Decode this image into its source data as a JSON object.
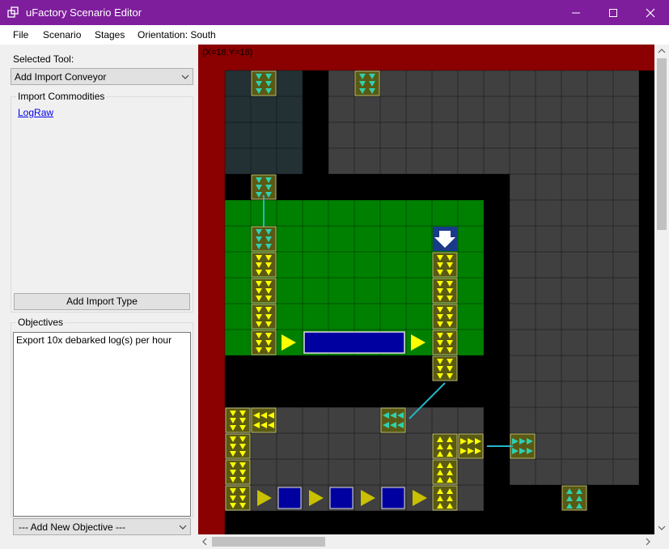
{
  "window": {
    "title": "uFactory Scenario Editor"
  },
  "menu": {
    "file": "File",
    "scenario": "Scenario",
    "stages": "Stages",
    "orientation": "Orientation: South"
  },
  "left": {
    "selected_tool_label": "Selected Tool:",
    "selected_tool_value": "Add Import Conveyor",
    "import_commodities_title": "Import Commodities",
    "commodities": [
      "LogRaw"
    ],
    "add_import_button": "Add Import Type",
    "objectives_title": "Objectives",
    "objectives_text": "Export 10x debarked log(s) per hour",
    "add_objective_value": "--- Add New Objective ---"
  },
  "grid": {
    "coords": "(X=18,Y=16)"
  },
  "colors": {
    "titlebar": "#7e1e9c",
    "border_red": "#8b0000",
    "dark_teal": "#233135",
    "floor_gray": "#404040",
    "green_zone": "#008000",
    "conveyor": "#5a5a14",
    "arrow_yellow": "#ffff00",
    "arrow_teal": "#2fd0b0",
    "machine_blue": "#0000a0",
    "wire": "#22b8c8"
  }
}
